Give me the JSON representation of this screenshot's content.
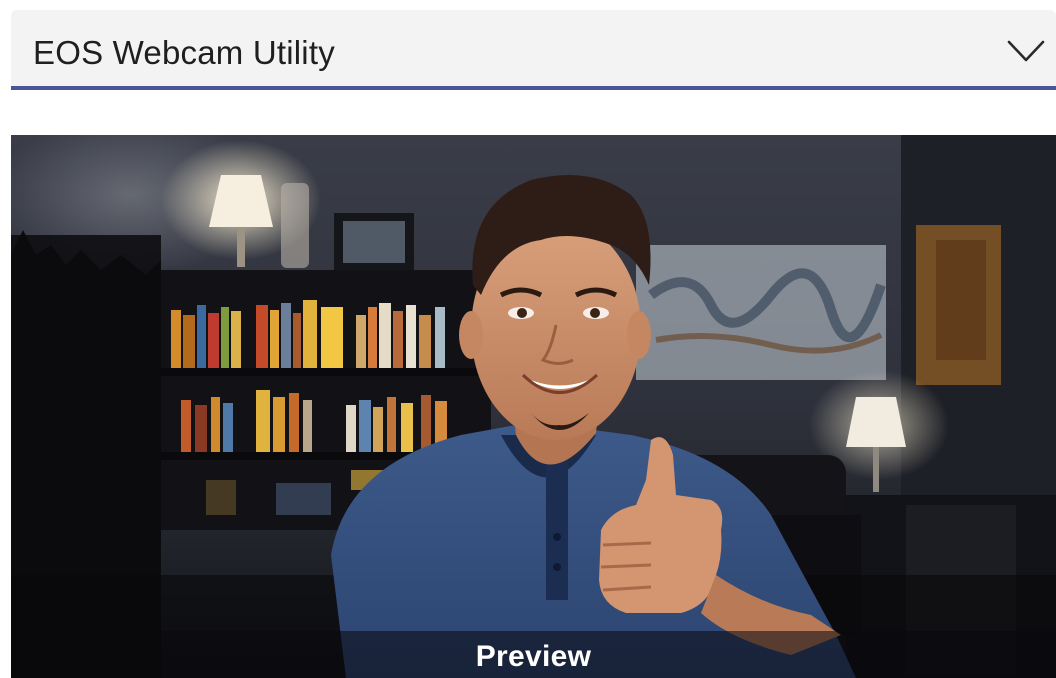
{
  "camera_select": {
    "selected_value": "EOS Webcam Utility",
    "icon": "chevron-down-icon",
    "accent_color": "#4a5596"
  },
  "preview": {
    "caption": "Preview",
    "image_subject": "webcam-video-frame"
  }
}
